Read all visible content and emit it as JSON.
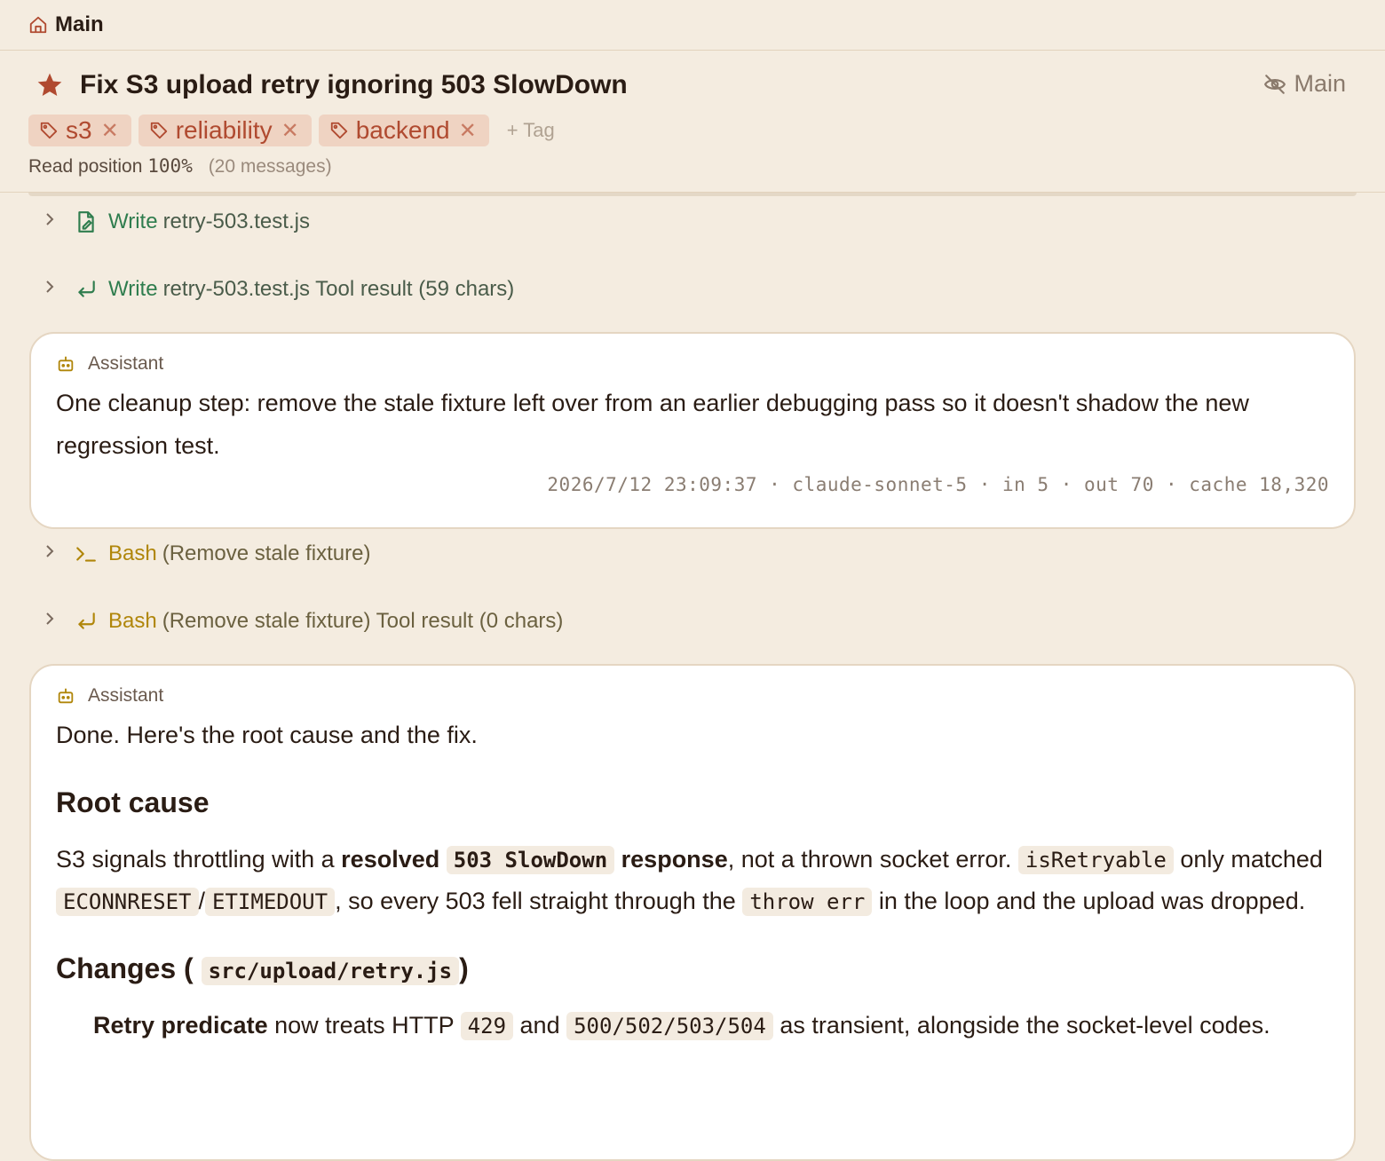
{
  "breadcrumb": {
    "label": "Main"
  },
  "header": {
    "title": "Fix S3 upload retry ignoring 503 SlowDown",
    "main_toggle_label": "Main",
    "tags": [
      "s3",
      "reliability",
      "backend"
    ],
    "add_tag_label": "+ Tag",
    "read_position_label": "Read position",
    "read_position_value": "100%",
    "message_count": "(20 messages)"
  },
  "timeline": {
    "row1": {
      "tool": "Write",
      "detail": "retry-503.test.js"
    },
    "row2": {
      "tool": "Write",
      "detail": "retry-503.test.js Tool result (59 chars)"
    },
    "msg1": {
      "role": "Assistant",
      "text": "One cleanup step: remove the stale fixture left over from an earlier debugging pass so it doesn't shadow the new regression test.",
      "meta": "2026/7/12 23:09:37 · claude-sonnet-5 · in 5 · out 70 · cache 18,320"
    },
    "row3": {
      "tool": "Bash",
      "detail": "(Remove stale fixture)"
    },
    "row4": {
      "tool": "Bash",
      "detail": "(Remove stale fixture) Tool result (0 chars)"
    },
    "msg2": {
      "role": "Assistant",
      "intro": "Done. Here's the root cause and the fix.",
      "h_root": "Root cause",
      "p1_a": "S3 signals throttling with a ",
      "p1_b": "resolved",
      "p1_code1": "503 SlowDown",
      "p1_c": "response",
      "p1_d": ", not a thrown socket error. ",
      "p1_code2": "isRetryable",
      "p1_e": " only matched ",
      "p1_code3": "ECONNRESET",
      "p1_f": "/",
      "p1_code4": "ETIMEDOUT",
      "p1_g": ", so every 503 fell straight through the ",
      "p1_code5": "throw err",
      "p1_h": " in the loop and the upload was dropped.",
      "h_changes": "Changes (",
      "h_changes_code": "src/upload/retry.js",
      "h_changes_end": ")",
      "li1_b": "Retry predicate",
      "li1_a": " now treats HTTP ",
      "li1_code1": "429",
      "li1_c": " and ",
      "li1_code2": "500/502/503/504",
      "li1_d": " as transient, alongside the socket-level codes."
    }
  },
  "colors": {
    "background": "#f4ece0",
    "accent": "#b04a30",
    "write_tool": "#2f7d4e",
    "bash_tool": "#b0860a"
  }
}
